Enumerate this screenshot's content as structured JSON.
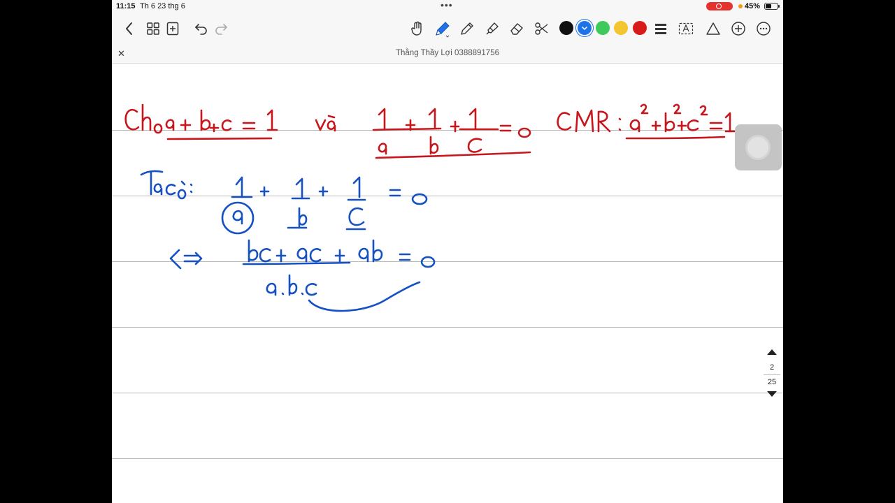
{
  "status_bar": {
    "time": "11:15",
    "date": "Th 6 23 thg 6",
    "battery_percent": "45%",
    "recording": true
  },
  "toolbar": {
    "tools": [
      "back-icon",
      "thumbnails-icon",
      "add-page-icon",
      "undo-icon",
      "redo-icon",
      "hand-icon",
      "pen-icon",
      "pencil-icon",
      "highlighter-icon",
      "eraser-icon",
      "scissors-icon",
      "line-width-icon",
      "text-icon",
      "shapes-icon",
      "add-icon",
      "more-icon"
    ],
    "colors": [
      "#111111",
      "#1e73e8",
      "#3ec95a",
      "#f2c531",
      "#d91a1a"
    ],
    "selected_color": "#1e73e8"
  },
  "document": {
    "title": "Thằng Thầy Lợi 0388891756"
  },
  "pager": {
    "current_page": "2",
    "total_pages": "25"
  },
  "ink": {
    "red_color": "#c8161d",
    "blue_color": "#1551c3",
    "line1": "Cho a + b + c = 1   và   1/a + 1/b + 1/c = 0   CMR:  a² + b² + c² = 1",
    "line2": "Ta có:  1/a + 1/b + 1/c = 0",
    "line3": "<=>  (bc + ac + ab)/(a.b.c) = 0"
  }
}
